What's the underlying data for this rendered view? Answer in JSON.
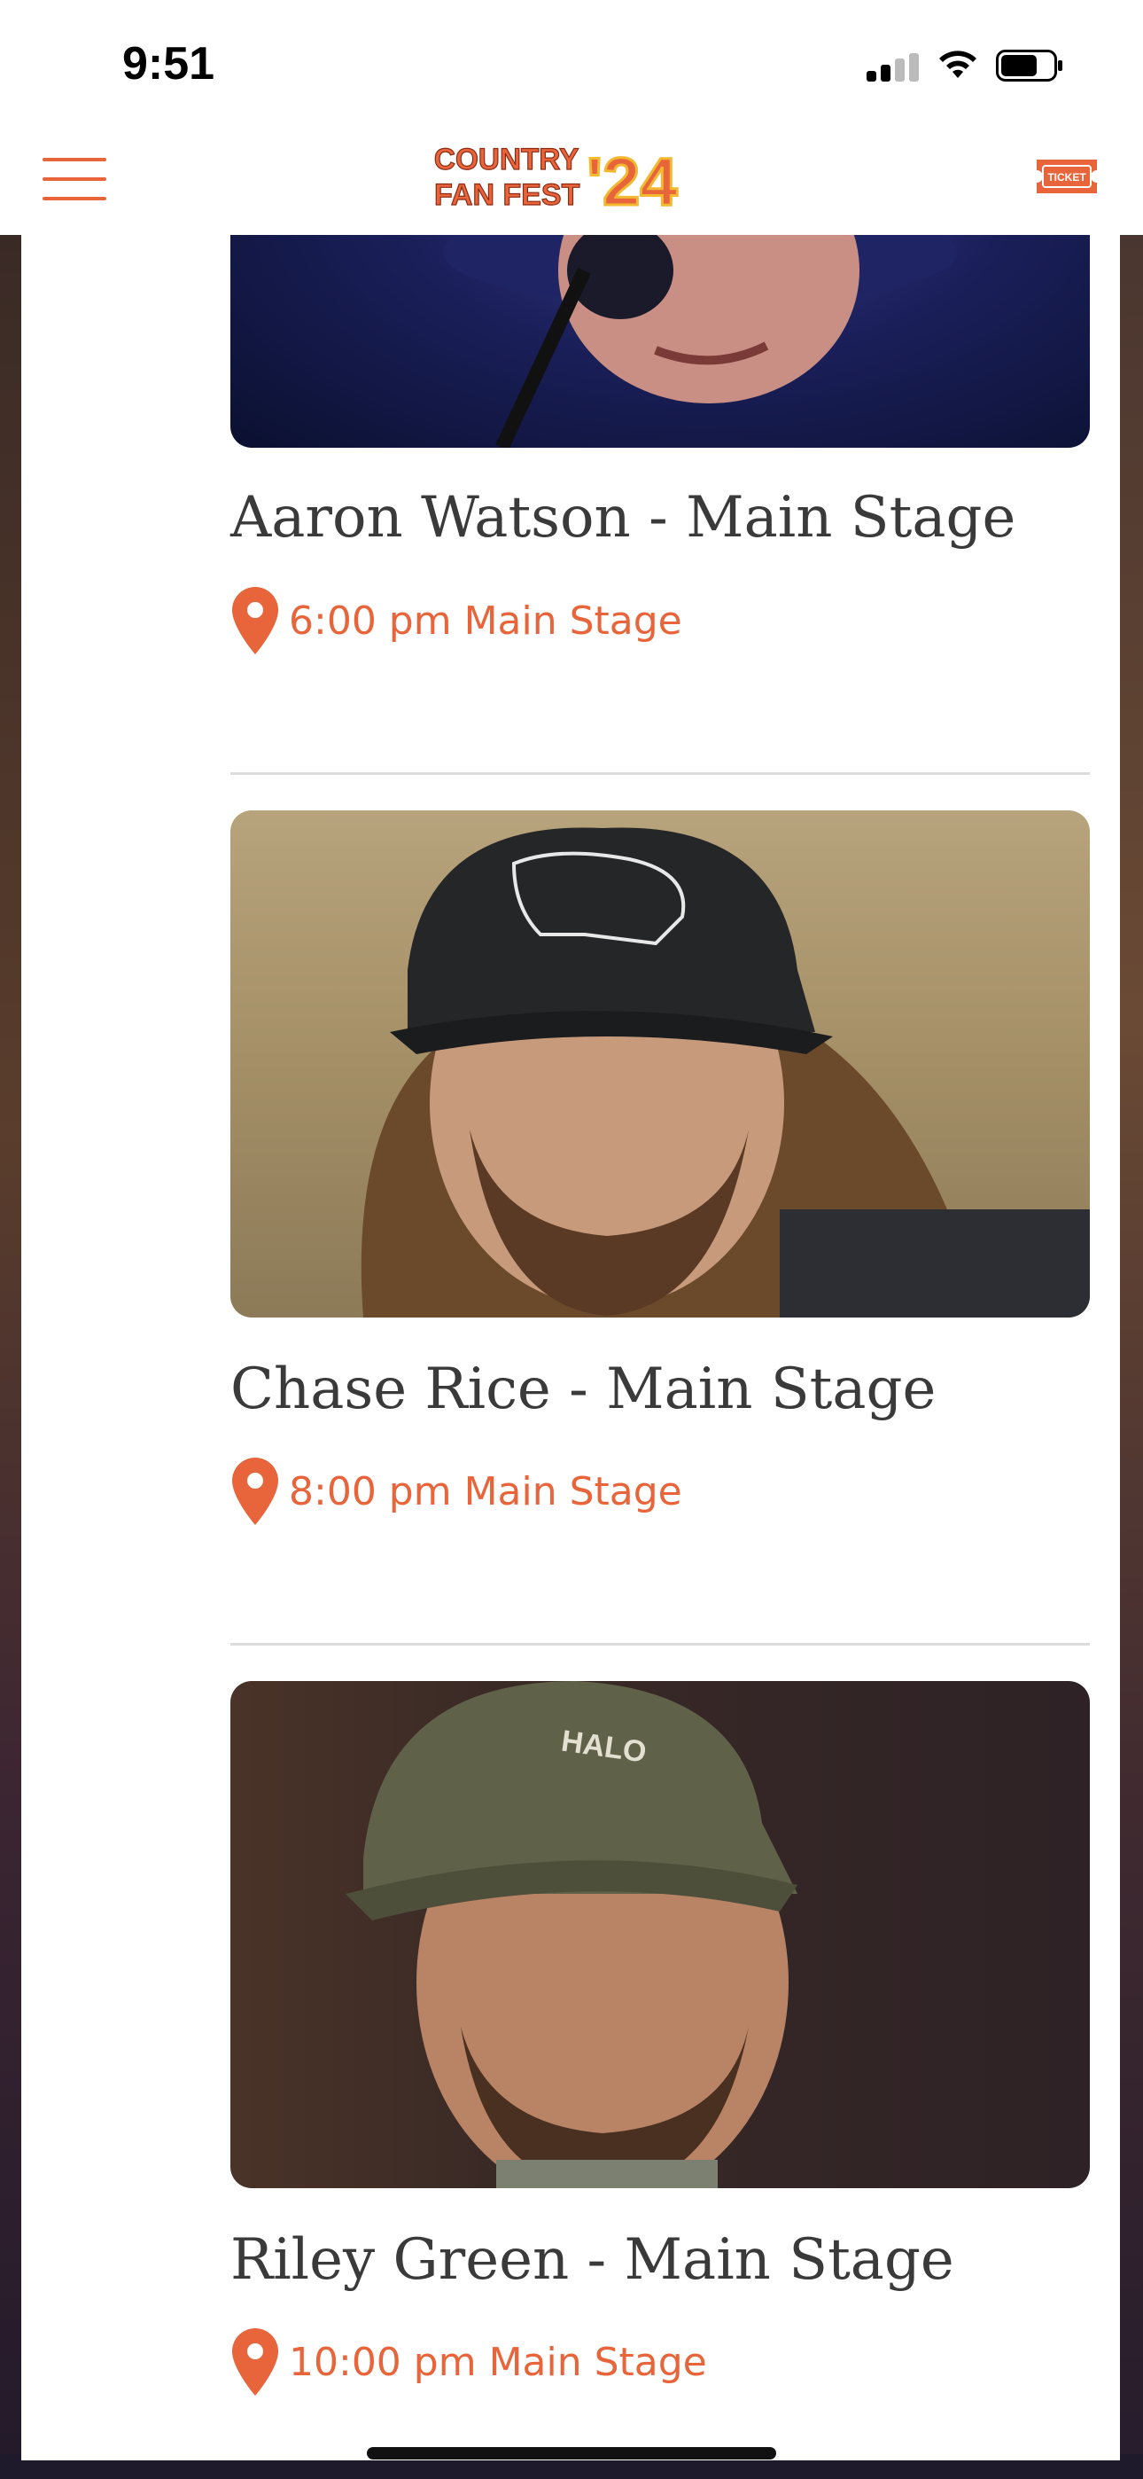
{
  "status_bar": {
    "time": "9:51"
  },
  "header": {
    "logo_line1": "COUNTRY",
    "logo_line2": "FAN FEST",
    "logo_year": "'24",
    "ticket_label": "TICKET"
  },
  "events": [
    {
      "title": "Aaron Watson - Main Stage",
      "time_location": "6:00 pm Main Stage"
    },
    {
      "title": "Chase Rice - Main Stage",
      "time_location": "8:00 pm Main Stage"
    },
    {
      "title": "Riley Green - Main Stage",
      "time_location": "10:00 pm Main Stage"
    }
  ],
  "colors": {
    "accent": "#e8643a",
    "title_text": "#3a3a3a",
    "divider": "#dcdcdc"
  }
}
